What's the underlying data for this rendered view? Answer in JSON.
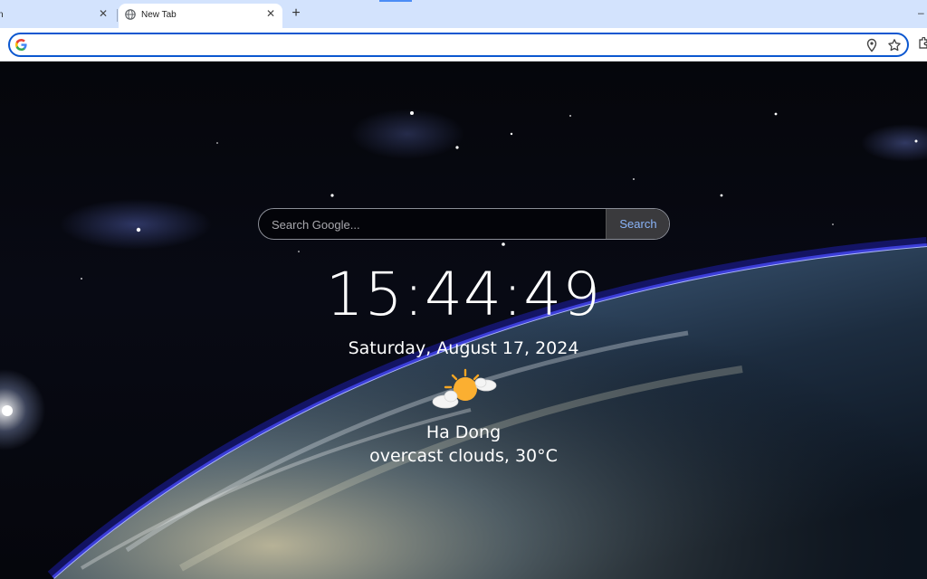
{
  "browser": {
    "tabs": [
      {
        "title": "n",
        "active": false
      },
      {
        "title": "New Tab",
        "active": true
      }
    ],
    "close_glyph": "✕",
    "new_tab_glyph": "+",
    "omnibox": {
      "value": "",
      "placeholder": ""
    },
    "icons": [
      "google-g-icon",
      "globe-icon",
      "location-pin-icon",
      "bookmark-star-icon",
      "extensions-icon"
    ]
  },
  "search": {
    "placeholder": "Search Google...",
    "button_label": "Search"
  },
  "clock": {
    "time": "15:44:49"
  },
  "date": {
    "text": "Saturday, August 17, 2024"
  },
  "weather": {
    "icon": "sun-behind-cloud-icon",
    "city": "Ha Dong",
    "description": "overcast clouds, 30°C"
  },
  "colors": {
    "tabstrip": "#d3e3fd",
    "omnibox_focus": "#0b57d0",
    "search_button_text": "#8ab4f8",
    "sun": "#f6a623"
  }
}
